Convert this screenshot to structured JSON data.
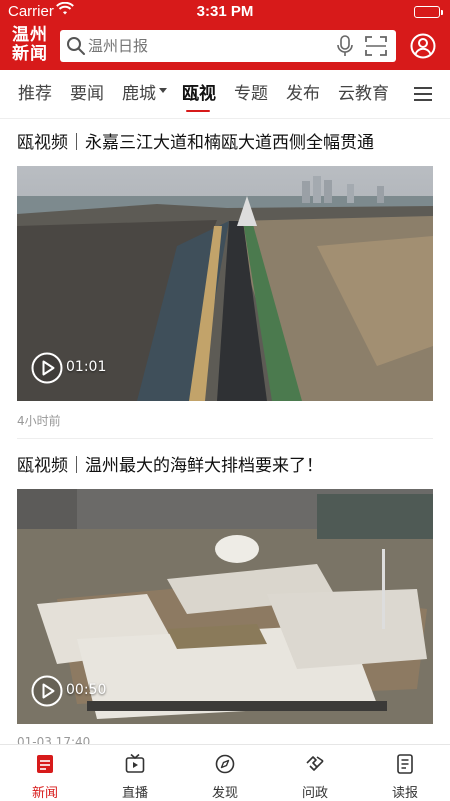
{
  "status": {
    "carrier": "Carrier",
    "time": "3:31 PM"
  },
  "header": {
    "logo_line1": "温州",
    "logo_line2": "新闻",
    "search_placeholder": "温州日报"
  },
  "tabs": [
    {
      "label": "推荐"
    },
    {
      "label": "要闻"
    },
    {
      "label": "鹿城"
    },
    {
      "label": "瓯视"
    },
    {
      "label": "专题"
    },
    {
      "label": "发布"
    },
    {
      "label": "云教育"
    }
  ],
  "active_tab": "瓯视",
  "articles": [
    {
      "title": "瓯视频｜永嘉三江大道和楠瓯大道西侧全幅贯通",
      "duration": "01:01",
      "time": "4小时前"
    },
    {
      "title": "瓯视频｜温州最大的海鲜大排档要来了！",
      "duration": "00:50",
      "time": "01-03 17:40"
    }
  ],
  "bottom_nav": [
    {
      "label": "新闻",
      "icon": "news-icon"
    },
    {
      "label": "直播",
      "icon": "live-tv-icon"
    },
    {
      "label": "发现",
      "icon": "compass-icon"
    },
    {
      "label": "问政",
      "icon": "handshake-icon"
    },
    {
      "label": "读报",
      "icon": "newspaper-icon"
    }
  ],
  "colors": {
    "brand": "#d71a1a"
  }
}
